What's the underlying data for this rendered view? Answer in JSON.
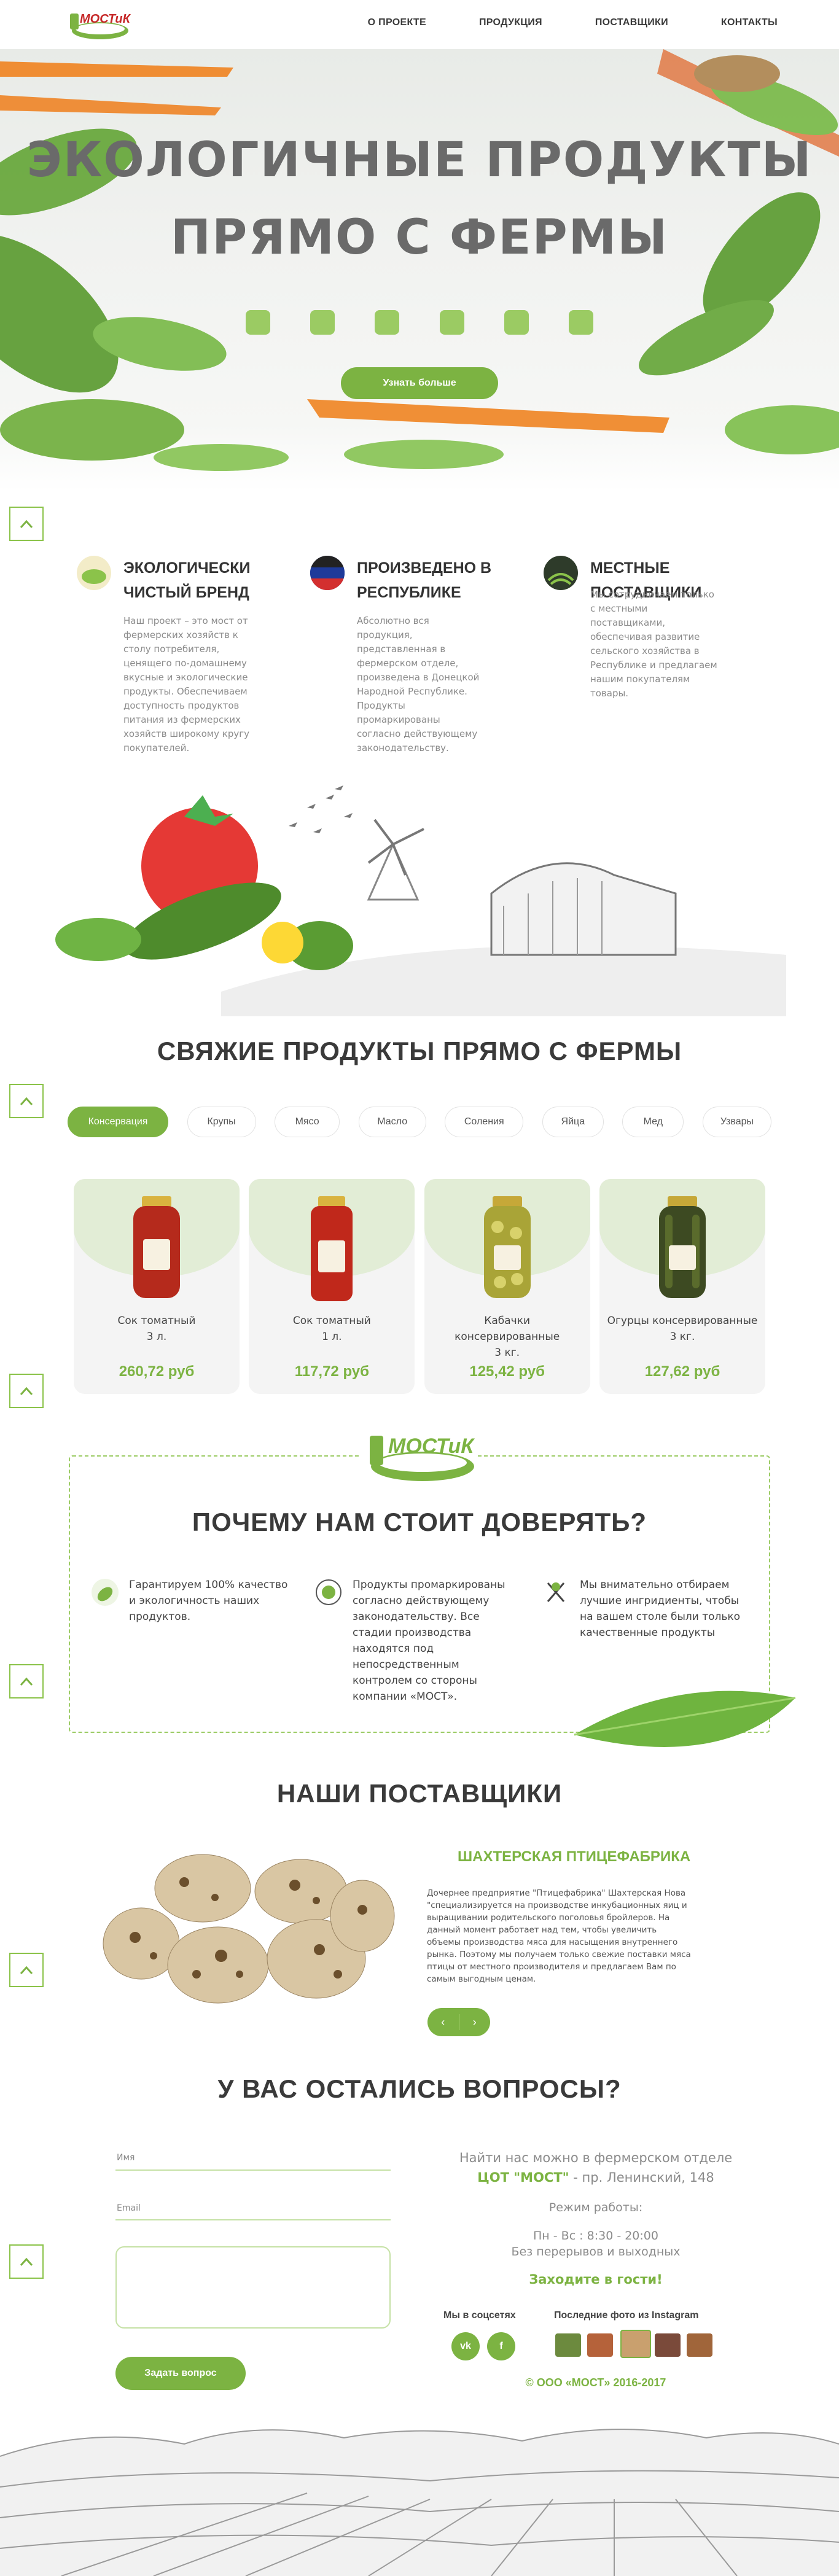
{
  "header": {
    "logo_text": "МОСТиК",
    "nav": [
      "О ПРОЕКТЕ",
      "ПРОДУКЦИЯ",
      "ПОСТАВЩИКИ",
      "КОНТАКТЫ"
    ]
  },
  "hero": {
    "title_line1": "ЭКОЛОГИЧНЫЕ ПРОДУКТЫ",
    "title_line2": "ПРЯМО С ФЕРМЫ",
    "button": "Узнать больше"
  },
  "features": [
    {
      "title": "ЭКОЛОГИЧЕСКИ ЧИСТЫЙ БРЕНД",
      "text": "Наш проект – это мост от фермерских хозяйств к столу потребителя, ценящего по-домашнему вкусные и экологические продукты. Обеспечиваем доступность продуктов питания из фермерских хозяйств широкому кругу покупателей."
    },
    {
      "title": "ПРОИЗВЕДЕНО В РЕСПУБЛИКЕ",
      "text": "Абсолютно вся продукция, представленная в фермерском отделе, произведена в Донецкой Народной Республике. Продукты промаркированы согласно действующему законодательству."
    },
    {
      "title": "МЕСТНЫЕ ПОСТАВЩИКИ",
      "text": "Мы сотрудничаем только с местными поставщиками, обеспечивая развитие сельского хозяйства в Республике и предлагаем нашим покупателям товары."
    }
  ],
  "products_section": {
    "title": "СВЯЖИЕ ПРОДУКТЫ ПРЯМО С ФЕРМЫ",
    "categories": [
      "Консервация",
      "Крупы",
      "Мясо",
      "Масло",
      "Соления",
      "Яйца",
      "Мед",
      "Узвары"
    ],
    "active_category": "Консервация",
    "products": [
      {
        "name": "Сок томатный",
        "size": "3 л.",
        "price": "260,72 руб"
      },
      {
        "name": "Сок томатный",
        "size": "1 л.",
        "price": "117,72 руб"
      },
      {
        "name": "Кабачки консервированные",
        "size": "3 кг.",
        "price": "125,42 руб"
      },
      {
        "name": "Огурцы консервированные",
        "size": "3 кг.",
        "price": "127,62 руб"
      }
    ]
  },
  "trust": {
    "logo_text": "МОСТиК",
    "title": "ПОЧЕМУ НАМ СТОИТ ДОВЕРЯТЬ?",
    "items": [
      "Гарантируем 100% качество и экологичность наших продуктов.",
      "Продукты промаркированы согласно действующему законодательству. Все стадии производства находятся под непосредственным контролем со стороны компании «МОСТ».",
      "Мы внимательно отбираем лучшие ингридиенты, чтобы на вашем столе были только качественные продукты"
    ]
  },
  "suppliers": {
    "title": "НАШИ ПОСТАВЩИКИ",
    "name": "ШАХТЕРСКАЯ ПТИЦЕФАБРИКА",
    "text": "Дочернее предприятие \"Птицефабрика\" Шахтерская Нова \"специализируется на производстве инкубационных яиц и выращивании родительского поголовья бройлеров. На данный момент работает над тем, чтобы увеличить объемы производства мяса для насыщения внутреннего рынка. Поэтому мы получаем только свежие поставки мяса птицы от местного производителя и предлагаем Вам по самым выгодным ценам.",
    "prev": "‹",
    "next": "›"
  },
  "contacts": {
    "title": "У ВАС ОСТАЛИСЬ ВОПРОСЫ?",
    "name_label": "Имя",
    "email_label": "Email",
    "submit": "Задать вопрос",
    "find_us": "Найти нас можно в фермерском отделе",
    "store": "ЦОТ \"МОСТ\"",
    "address": " - пр. Ленинский, 148",
    "hours_title": "Режим работы:",
    "hours": "Пн - Вс : 8:30 - 20:00",
    "hours_note": "Без перерывов и выходных",
    "welcome": "Заходите в гости!",
    "social_label": "Мы в соцсетях",
    "social": [
      "vk",
      "f"
    ],
    "instagram_label": "Последние фото из Instagram",
    "copyright": "© ООО «МОСТ» 2016-2017"
  },
  "colors": {
    "accent": "#7cb342",
    "light_accent": "#e2edd6",
    "text": "#444444"
  }
}
